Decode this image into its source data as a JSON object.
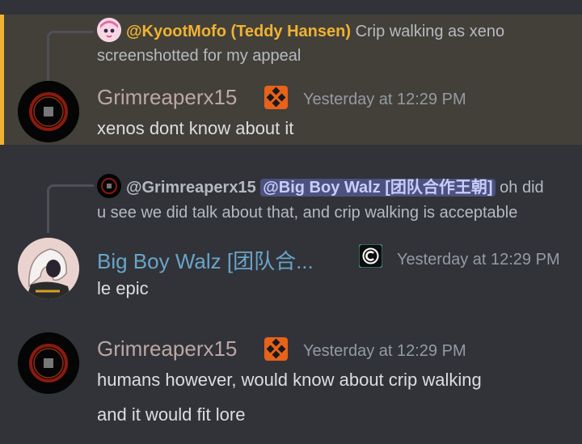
{
  "colors": {
    "background": "#313338",
    "highlight_bg": "#434039",
    "highlight_border": "#f0b232",
    "grim_name": "#bca7a4",
    "walz_name": "#6aa4c9",
    "kyoot_name": "#f0b232",
    "mention_bg": "#4d5180"
  },
  "messages": [
    {
      "reply": {
        "name": "@KyootMofo (Teddy Hansen)",
        "text_line1": "Crip walking as xeno",
        "text_line2": "screenshotted for my appeal",
        "avatar_icon": "anime-avatar-icon"
      },
      "author": "Grimreaperx15",
      "badge_icon": "orange-diamond-badge-icon",
      "timestamp": "Yesterday at 12:29 PM",
      "content": "xenos dont know about it",
      "highlighted": true
    },
    {
      "reply": {
        "name": "@Grimreaperx15",
        "mention": "@Big Boy Walz [团队合作王朝]",
        "text_line1": "oh did",
        "text_line2": "u see we did talk about that, and crip walking is acceptable"
      },
      "author": "Big Boy Walz [团队合...",
      "badge_icon": "c-logo-badge-icon",
      "timestamp": "Yesterday at 12:29 PM",
      "content": "le epic"
    },
    {
      "author": "Grimreaperx15",
      "badge_icon": "orange-diamond-badge-icon",
      "timestamp": "Yesterday at 12:29 PM",
      "content_line1": "humans however, would know about crip walking",
      "content_line2": "and it would fit lore"
    }
  ]
}
